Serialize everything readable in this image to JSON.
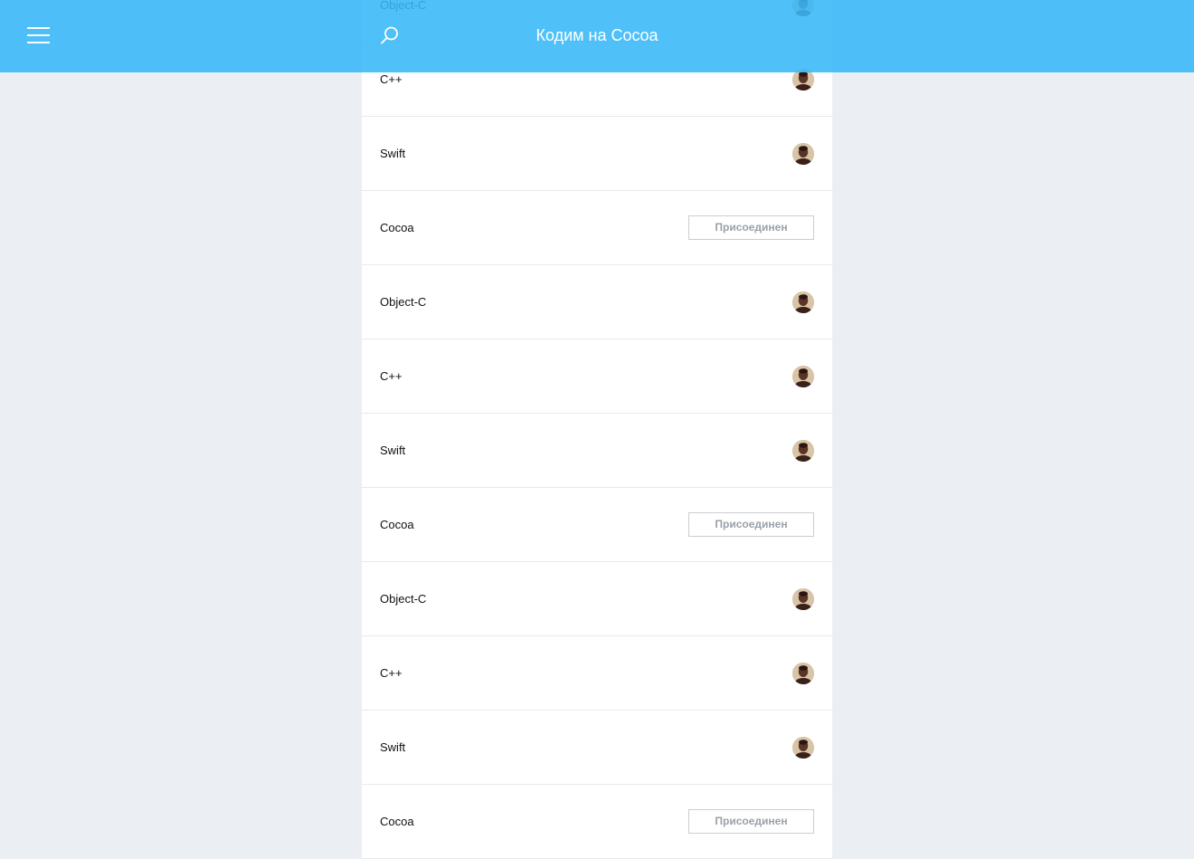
{
  "header": {
    "title": "Кодим на Cocoa"
  },
  "icons": {
    "menu": "hamburger-menu-icon",
    "search": "search-icon",
    "avatar": "user-avatar"
  },
  "colors": {
    "header_bg": "#38b7f8",
    "page_bg": "#ebeff3",
    "row_bg": "#ffffff",
    "button_text": "#9aa1a8"
  },
  "list": {
    "items": [
      {
        "label": "Object-C",
        "action": "avatar"
      },
      {
        "label": "C++",
        "action": "avatar"
      },
      {
        "label": "Swift",
        "action": "avatar"
      },
      {
        "label": "Cocoa",
        "action": "button",
        "button_label": "Присоединен"
      },
      {
        "label": "Object-C",
        "action": "avatar"
      },
      {
        "label": "C++",
        "action": "avatar"
      },
      {
        "label": "Swift",
        "action": "avatar"
      },
      {
        "label": "Cocoa",
        "action": "button",
        "button_label": "Присоединен"
      },
      {
        "label": "Object-C",
        "action": "avatar"
      },
      {
        "label": "C++",
        "action": "avatar"
      },
      {
        "label": "Swift",
        "action": "avatar"
      },
      {
        "label": "Cocoa",
        "action": "button",
        "button_label": "Присоединен"
      }
    ]
  }
}
